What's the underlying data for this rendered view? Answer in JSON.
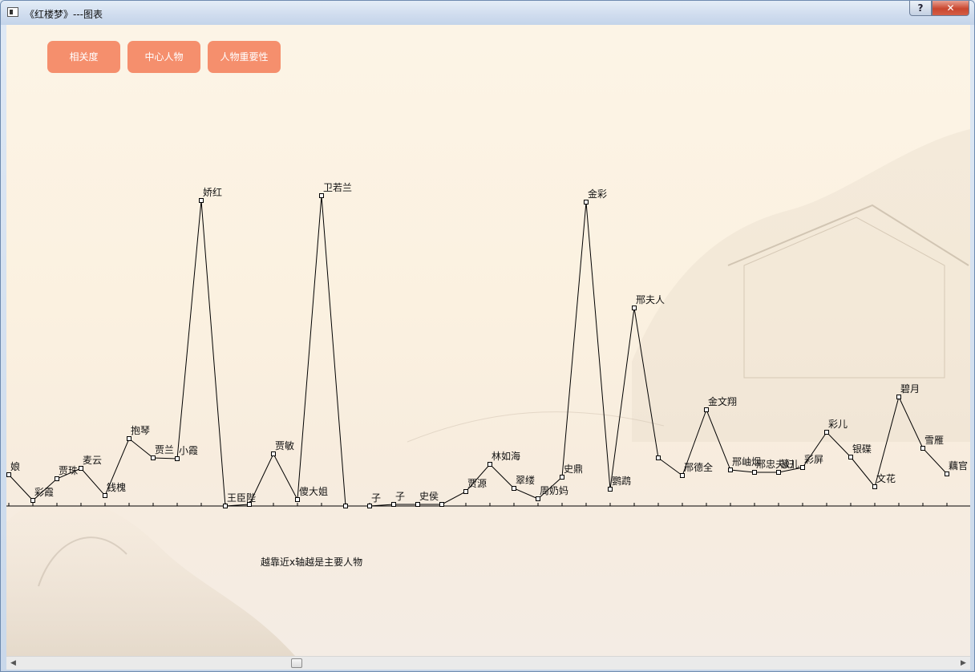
{
  "window": {
    "title": "《红楼梦》---图表",
    "help_label": "?",
    "close_label": "✕"
  },
  "toolbar": {
    "buttons": [
      {
        "label": "相关度"
      },
      {
        "label": "中心人物"
      },
      {
        "label": "人物重要性"
      }
    ]
  },
  "caption": "越靠近x轴越是主要人物",
  "chart_data": {
    "type": "line",
    "xlabel": "",
    "ylabel": "",
    "marker": "square",
    "color": "#000000",
    "points": [
      {
        "name": "娘",
        "value": 39
      },
      {
        "name": "彩霞",
        "value": 7
      },
      {
        "name": "贾珠",
        "value": 34
      },
      {
        "name": "麦云",
        "value": 47
      },
      {
        "name": "钱槐",
        "value": 13
      },
      {
        "name": "抱琴",
        "value": 84
      },
      {
        "name": "贾兰",
        "value": 60
      },
      {
        "name": "小霞",
        "value": 59
      },
      {
        "name": "娇红",
        "value": 381
      },
      {
        "name": "王臣陛",
        "value": 0
      },
      {
        "name": "",
        "value": 2
      },
      {
        "name": "贾敏",
        "value": 65
      },
      {
        "name": "傻大姐",
        "value": 8
      },
      {
        "name": "卫若兰",
        "value": 387
      },
      {
        "name": "",
        "value": 0
      },
      {
        "name": "子",
        "value": 0
      },
      {
        "name": "子",
        "value": 2
      },
      {
        "name": "史侯",
        "value": 2
      },
      {
        "name": "",
        "value": 2
      },
      {
        "name": "贾源",
        "value": 18
      },
      {
        "name": "林如海",
        "value": 52
      },
      {
        "name": "翠缕",
        "value": 22
      },
      {
        "name": "周奶妈",
        "value": 9
      },
      {
        "name": "史鼎",
        "value": 36
      },
      {
        "name": "金彩",
        "value": 379
      },
      {
        "name": "鹦鹉",
        "value": 21
      },
      {
        "name": "邢夫人",
        "value": 247
      },
      {
        "name": "",
        "value": 60
      },
      {
        "name": "邢德全",
        "value": 38
      },
      {
        "name": "金文翔",
        "value": 120
      },
      {
        "name": "邢岫烟",
        "value": 45
      },
      {
        "name": "邢忠夫妇",
        "value": 42
      },
      {
        "name": "篆儿",
        "value": 42
      },
      {
        "name": "彩屏",
        "value": 48
      },
      {
        "name": "彩儿",
        "value": 92
      },
      {
        "name": "银碟",
        "value": 61
      },
      {
        "name": "文花",
        "value": 24
      },
      {
        "name": "碧月",
        "value": 136
      },
      {
        "name": "雪雁",
        "value": 72
      },
      {
        "name": "藕官",
        "value": 40
      }
    ]
  }
}
